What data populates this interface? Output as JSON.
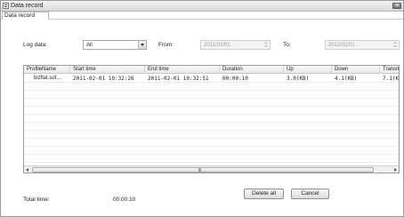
{
  "window": {
    "title": "Data record"
  },
  "tabs": [
    {
      "label": "Data record"
    }
  ],
  "filters": {
    "log_data_label": "Log data:",
    "log_data_value": "All",
    "from_label": "From:",
    "from_value": "2011/02/01",
    "to_label": "To:",
    "to_value": "2011/02/01"
  },
  "table": {
    "columns": [
      "ProfileName",
      "Start time",
      "End time",
      "Duration",
      "Up",
      "Down",
      "Transmis"
    ],
    "rows": [
      [
        "bizflat.sof...",
        "2011-02-01 10:32:26",
        "2011-02-01 10:32:51",
        "00:00:10",
        "3.0(KB)",
        "4.1(KB)",
        "7.1(KB)"
      ]
    ],
    "scroll_grip": "III"
  },
  "footer": {
    "total_time_label": "Total time:",
    "total_time_value": "00:00:10",
    "delete_all_label": "Delete all",
    "cancel_label": "Cancel"
  }
}
